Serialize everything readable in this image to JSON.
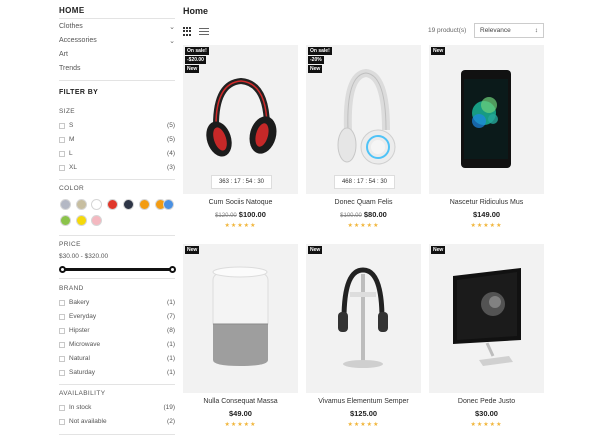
{
  "sidebar": {
    "title": "HOME",
    "categories": [
      {
        "label": "Clothes",
        "expandable": true
      },
      {
        "label": "Accessories",
        "expandable": true
      },
      {
        "label": "Art",
        "expandable": false
      },
      {
        "label": "Trends",
        "expandable": false
      }
    ],
    "filter_by": "FILTER BY",
    "size": {
      "label": "SIZE",
      "options": [
        {
          "label": "S",
          "count": "(5)"
        },
        {
          "label": "M",
          "count": "(5)"
        },
        {
          "label": "L",
          "count": "(4)"
        },
        {
          "label": "XL",
          "count": "(3)"
        }
      ]
    },
    "color": {
      "label": "COLOR",
      "swatches": [
        "#b4b8c4",
        "#c7bea0",
        "#ffffff",
        "#e0372a",
        "#2e3546",
        "#f39c12",
        "#f39c12",
        "#4a90e2",
        "#8bc34a",
        "#f5d90a",
        "#f4b8c0"
      ]
    },
    "price": {
      "label": "PRICE",
      "range": "$30.00 - $320.00",
      "min_fraction": 0,
      "max_fraction": 1
    },
    "brand": {
      "label": "BRAND",
      "options": [
        {
          "label": "Bakery",
          "count": "(1)"
        },
        {
          "label": "Everyday",
          "count": "(7)"
        },
        {
          "label": "Hipster",
          "count": "(8)"
        },
        {
          "label": "Microwave",
          "count": "(1)"
        },
        {
          "label": "Natural",
          "count": "(1)"
        },
        {
          "label": "Saturday",
          "count": "(1)"
        }
      ]
    },
    "availability": {
      "label": "AVAILABILITY",
      "options": [
        {
          "label": "In stock",
          "count": "(19)"
        },
        {
          "label": "Not available",
          "count": "(2)"
        }
      ]
    }
  },
  "main": {
    "title": "Home",
    "product_count": "19 product(s)",
    "sort": {
      "selected": "Relevance"
    },
    "products": [
      {
        "name": "Cum Sociis Natoque",
        "old_price": "$120.00",
        "price": "$100.00",
        "badges": [
          "On sale!",
          "-$20.00",
          "New"
        ],
        "timer": "363 : 17 : 54 : 30",
        "stars": "★★★★★",
        "icon": "headphones-red-icon"
      },
      {
        "name": "Donec Quam Felis",
        "old_price": "$100.00",
        "price": "$80.00",
        "badges": [
          "On sale!",
          "-20%",
          "New"
        ],
        "timer": "468 : 17 : 54 : 30",
        "stars": "★★★★★",
        "icon": "headphones-white-icon"
      },
      {
        "name": "Nascetur Ridiculus Mus",
        "old_price": "",
        "price": "$149.00",
        "badges": [
          "New"
        ],
        "timer": "",
        "stars": "★★★★★",
        "icon": "smartphone-icon"
      },
      {
        "name": "Nulla Consequat Massa",
        "old_price": "",
        "price": "$49.00",
        "badges": [
          "New"
        ],
        "timer": "",
        "stars": "★★★★★",
        "icon": "smart-speaker-icon"
      },
      {
        "name": "Vivamus Elementum Semper",
        "old_price": "",
        "price": "$125.00",
        "badges": [
          "New"
        ],
        "timer": "",
        "stars": "★★★★★",
        "icon": "headphone-stand-icon"
      },
      {
        "name": "Donec Pede Justo",
        "old_price": "",
        "price": "$30.00",
        "badges": [
          "New"
        ],
        "timer": "",
        "stars": "★★★★★",
        "icon": "desktop-monitor-icon"
      }
    ]
  }
}
